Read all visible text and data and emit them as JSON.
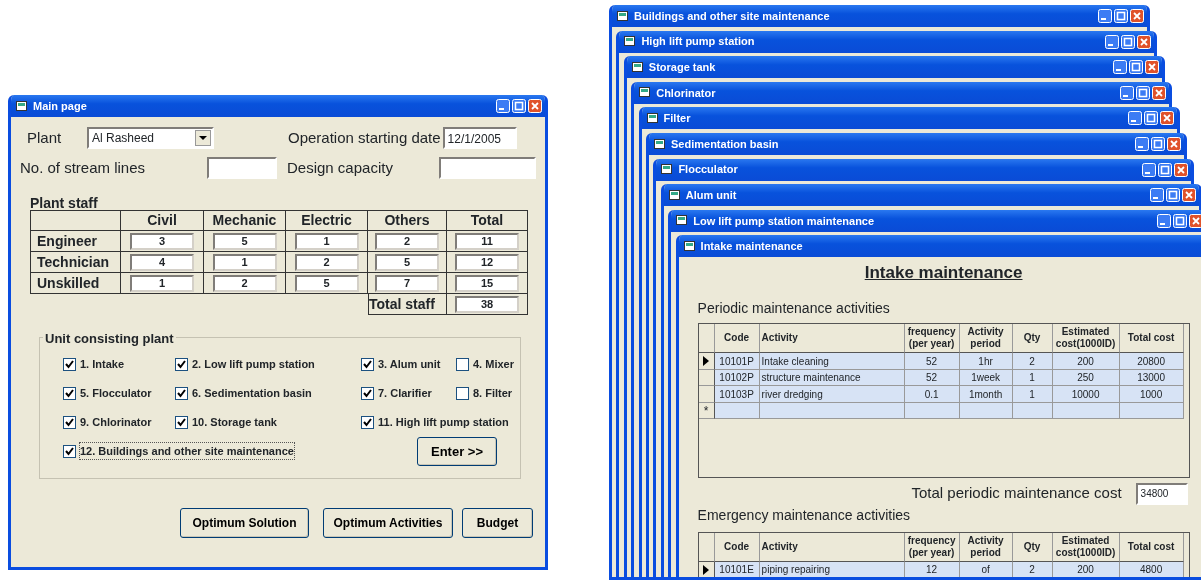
{
  "main_window": {
    "title": "Main page",
    "plant_label": "Plant",
    "plant_value": "Al Rasheed",
    "start_date_label": "Operation starting date",
    "start_date_value": "12/1/2005",
    "stream_lines_label": "No. of stream lines",
    "design_capacity_label": "Design capacity",
    "staff": {
      "title": "Plant staff",
      "columns": [
        "Civil",
        "Mechanic",
        "Electric",
        "Others",
        "Total"
      ],
      "rows": [
        {
          "label": "Engineer",
          "values": [
            "3",
            "5",
            "1",
            "2",
            "11"
          ]
        },
        {
          "label": "Technician",
          "values": [
            "4",
            "1",
            "2",
            "5",
            "12"
          ]
        },
        {
          "label": "Unskilled",
          "values": [
            "1",
            "2",
            "5",
            "7",
            "15"
          ]
        }
      ],
      "total_label": "Total staff",
      "total_value": "38"
    },
    "units": {
      "title": "Unit consisting plant",
      "rows": [
        [
          {
            "label": "1. Intake",
            "checked": true
          },
          {
            "label": "2. Low lift pump station",
            "checked": true
          },
          {
            "label": "3. Alum unit",
            "checked": true
          },
          {
            "label": "4. Mixer",
            "checked": false
          }
        ],
        [
          {
            "label": "5. Flocculator",
            "checked": true
          },
          {
            "label": "6. Sedimentation basin",
            "checked": true
          },
          {
            "label": "7. Clarifier",
            "checked": true
          },
          {
            "label": "8. Filter",
            "checked": false
          }
        ],
        [
          {
            "label": "9. Chlorinator",
            "checked": true
          },
          {
            "label": "10. Storage tank",
            "checked": true
          },
          {
            "label": "11. High lift pump station",
            "checked": true
          }
        ],
        [
          {
            "label": "12. Buildings and other site maintenance",
            "checked": true
          }
        ]
      ],
      "enter_button": "Enter >>"
    },
    "buttons": [
      "Optimum Solution",
      "Optimum Activities",
      "Budget"
    ]
  },
  "windows": [
    {
      "title": "Buildings and other site maintenance"
    },
    {
      "title": "High lift pump station"
    },
    {
      "title": "Storage tank"
    },
    {
      "title": "Chlorinator"
    },
    {
      "title": "Filter"
    },
    {
      "title": "Sedimentation basin"
    },
    {
      "title": "Flocculator"
    },
    {
      "title": "Alum unit"
    },
    {
      "title": "Low lift pump station maintenance"
    }
  ],
  "intake_window": {
    "title": "Intake maintenance",
    "heading": "Intake maintenance",
    "periodic": {
      "title": "Periodic  maintenance activities",
      "columns": [
        "Code",
        "Activity",
        "frequency (per year)",
        "Activity period",
        "Qty",
        "Estimated cost(1000ID)",
        "Total cost"
      ],
      "rows": [
        {
          "selected": true,
          "cells": [
            "10101P",
            "Intake cleaning",
            "52",
            "1hr",
            "2",
            "200",
            "20800"
          ]
        },
        {
          "selected": false,
          "cells": [
            "10102P",
            "structure maintenance",
            "52",
            "1week",
            "1",
            "250",
            "13000"
          ]
        },
        {
          "selected": false,
          "cells": [
            "10103P",
            "river dredging",
            "0.1",
            "1month",
            "1",
            "10000",
            "1000"
          ]
        }
      ],
      "new_row_marker": "*"
    },
    "total_label": "Total periodic maintenance cost",
    "total_value": "34800",
    "emergency": {
      "title": "Emergency maintenance activities",
      "columns": [
        "Code",
        "Activity",
        "frequency (per year)",
        "Activity period",
        "Qty",
        "Estimated cost(1000ID)",
        "Total cost"
      ],
      "rows": [
        {
          "selected": true,
          "cells": [
            "10101E",
            "piping repairing",
            "12",
            "of",
            "2",
            "200",
            "4800"
          ]
        }
      ]
    }
  }
}
